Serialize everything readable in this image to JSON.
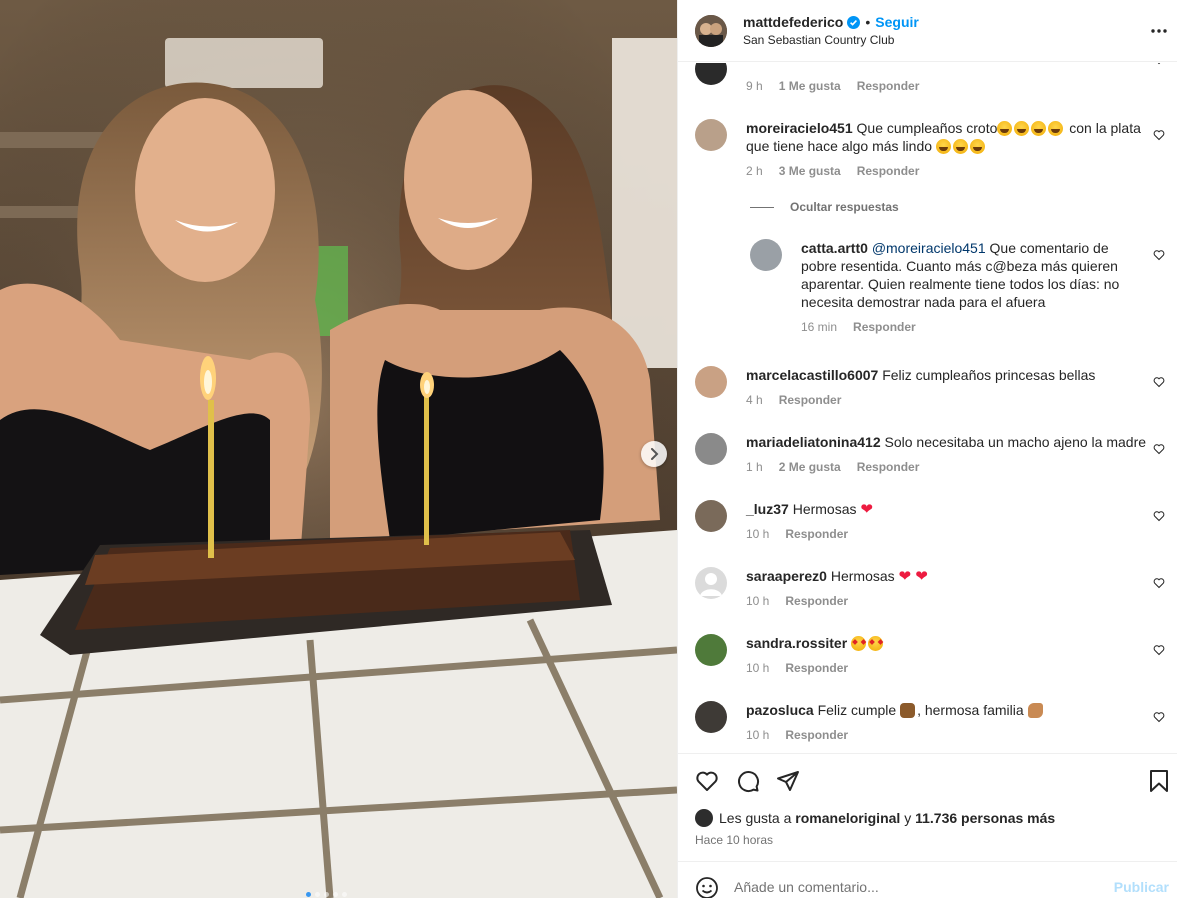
{
  "post": {
    "username": "mattdefederico",
    "follow_label": "Seguir",
    "separator": "•",
    "location": "San Sebastian Country Club",
    "verified_icon": "verified-badge-icon",
    "accent": "#0095f6"
  },
  "carousel": {
    "next_icon": "chevron-right-icon",
    "slide_count": 5,
    "current_slide": 1
  },
  "comments": [
    {
      "meta": {
        "time": "9 h",
        "likes": "1 Me gusta",
        "reply": "Responder"
      }
    },
    {
      "username": "moreiracielo451",
      "text_a": "Que cumpleaños croto",
      "text_b": "con la plata que tiene hace algo más lindo",
      "emojis_a": 4,
      "emojis_b": 3,
      "meta": {
        "time": "2 h",
        "likes": "3 Me gusta",
        "reply": "Responder"
      }
    },
    {
      "hide_label": "Ocultar respuestas"
    },
    {
      "username": "catta.artt0",
      "mention": "@moreiracielo451",
      "text": "Que comentario de pobre resentida. Cuanto más c@beza más quieren aparentar. Quien realmente tiene todos los días: no necesita demostrar nada para el afuera",
      "meta": {
        "time": "16 min",
        "reply": "Responder"
      }
    },
    {
      "username": "marcelacastillo6007",
      "text": "Feliz cumpleaños princesas bellas",
      "meta": {
        "time": "4 h",
        "reply": "Responder"
      }
    },
    {
      "username": "mariadeliatonina412",
      "text": "Solo necesitaba un macho ajeno la madre",
      "meta": {
        "time": "1 h",
        "likes": "2 Me gusta",
        "reply": "Responder"
      }
    },
    {
      "username": "_luz37",
      "text": "Hermosas",
      "hearts": "❤",
      "meta": {
        "time": "10 h",
        "reply": "Responder"
      }
    },
    {
      "username": "saraaperez0",
      "text": "Hermosas",
      "hearts": "❤ ❤",
      "meta": {
        "time": "10 h",
        "reply": "Responder"
      }
    },
    {
      "username": "sandra.rossiter",
      "meta": {
        "time": "10 h",
        "reply": "Responder"
      }
    },
    {
      "username": "pazosluca",
      "text_a": "Feliz cumple",
      "text_b": ", hermosa familia",
      "meta": {
        "time": "10 h",
        "reply": "Responder"
      }
    }
  ],
  "actions": {
    "like_icon": "heart-icon",
    "comment_icon": "comment-bubble-icon",
    "share_icon": "paper-plane-icon",
    "save_icon": "bookmark-icon",
    "likes_prefix": "Les gusta a",
    "likes_user": "romaneloriginal",
    "likes_and": "y",
    "likes_count": "11.736 personas más",
    "posted": "Hace 10 horas"
  },
  "composer": {
    "placeholder": "Añade un comentario...",
    "publish_label": "Publicar",
    "emoji_icon": "smiley-icon"
  }
}
